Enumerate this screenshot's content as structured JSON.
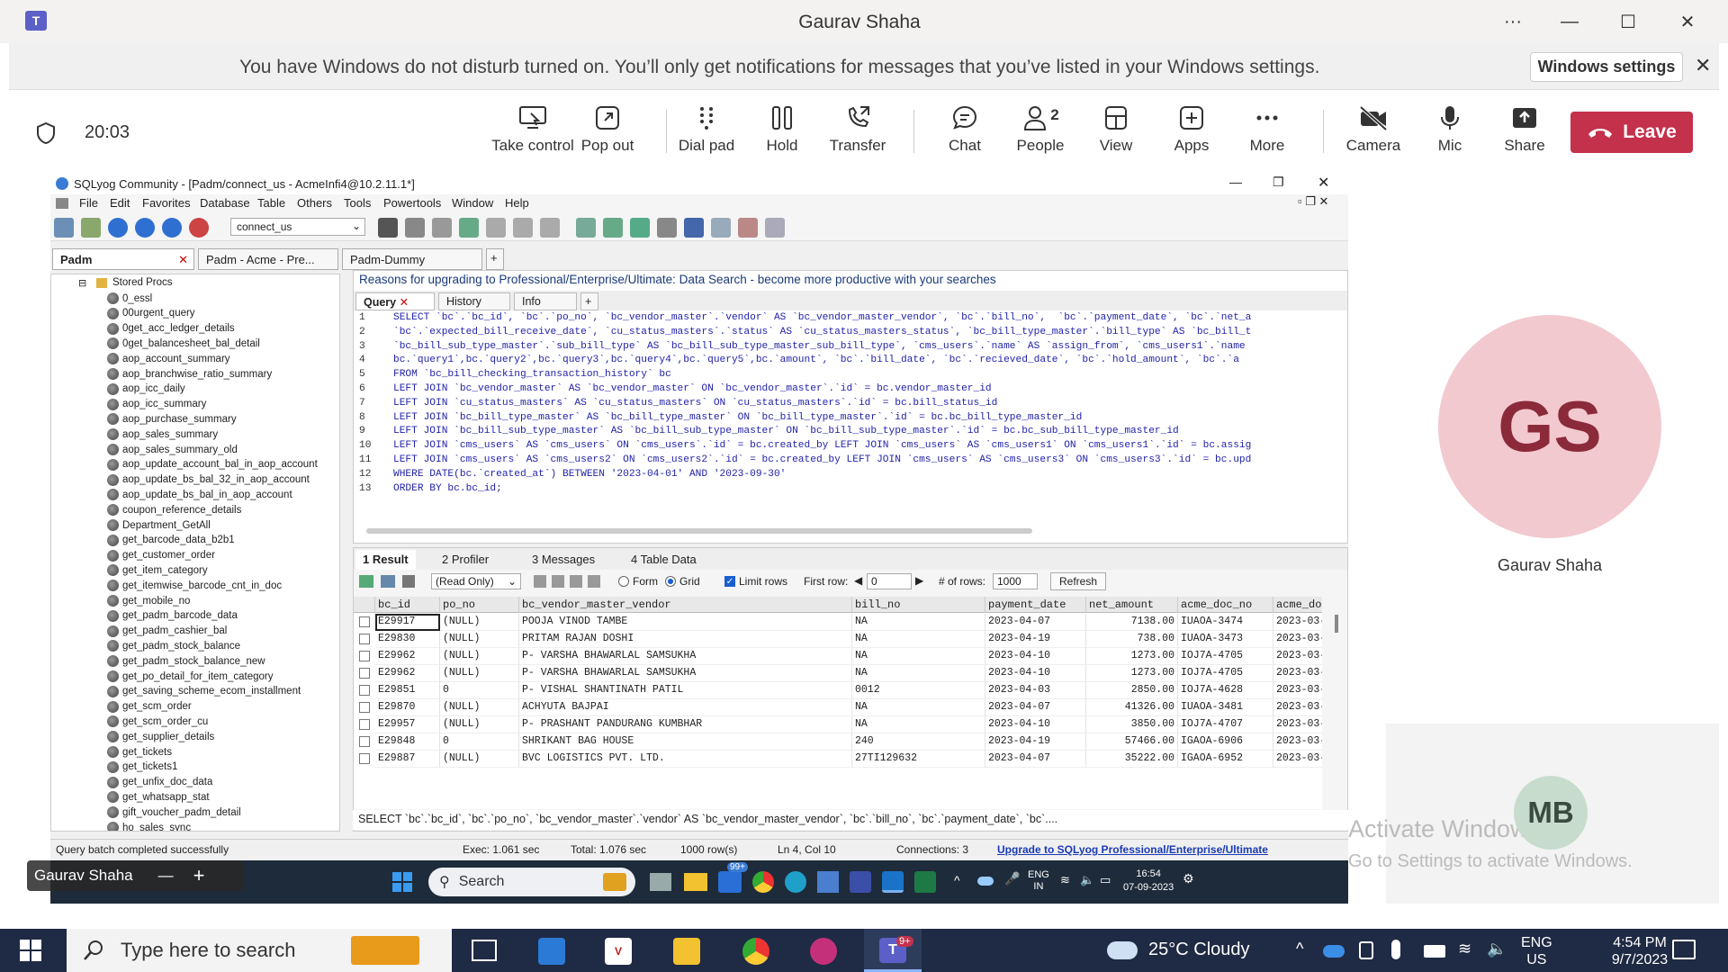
{
  "teams": {
    "title": "Gaurav Shaha",
    "dnd_message": "You have Windows do not disturb turned on. You’ll only get notifications for messages that you’ve listed in your Windows settings.",
    "windows_settings_button": "Windows settings",
    "timer": "20:03",
    "tools": [
      {
        "label": "Take control",
        "icon": "take-control-icon"
      },
      {
        "label": "Pop out",
        "icon": "pop-out-icon"
      },
      {
        "label": "Dial pad",
        "icon": "dial-pad-icon"
      },
      {
        "label": "Hold",
        "icon": "hold-icon"
      },
      {
        "label": "Transfer",
        "icon": "transfer-icon"
      },
      {
        "label": "Chat",
        "icon": "chat-icon"
      },
      {
        "label": "People",
        "icon": "people-icon"
      },
      {
        "label": "View",
        "icon": "view-icon"
      },
      {
        "label": "Apps",
        "icon": "apps-icon"
      },
      {
        "label": "More",
        "icon": "more-icon"
      },
      {
        "label": "Camera",
        "icon": "camera-off-icon"
      },
      {
        "label": "Mic",
        "icon": "mic-icon"
      },
      {
        "label": "Share",
        "icon": "share-icon"
      }
    ],
    "people_count": "2",
    "leave_button": "Leave",
    "participant_main": {
      "initials": "GS",
      "name": "Gaurav Shaha"
    },
    "participant_other": {
      "initials": "MB"
    },
    "presenter_chip": "Gaurav Shaha",
    "activate_windows": "Activate Windows",
    "activate_windows_sub": "Go to Settings to activate Windows."
  },
  "sqlyog": {
    "title": "SQLyog Community - [Padm/connect_us - AcmeInfi4@10.2.11.1*]",
    "menu": [
      "File",
      "Edit",
      "Favorites",
      "Database",
      "Table",
      "Others",
      "Tools",
      "Powertools",
      "Window",
      "Help"
    ],
    "db_selector": "connect_us",
    "connection_tabs": [
      "Padm",
      "Padm - Acme - Pre...",
      "Padm-Dummy"
    ],
    "tree_root": "Stored Procs",
    "procs": [
      "0_essl",
      "00urgent_query",
      "0get_acc_ledger_details",
      "0get_balancesheet_bal_detail",
      "aop_account_summary",
      "aop_branchwise_ratio_summary",
      "aop_icc_daily",
      "aop_icc_summary",
      "aop_purchase_summary",
      "aop_sales_summary",
      "aop_sales_summary_old",
      "aop_update_account_bal_in_aop_account",
      "aop_update_bs_bal_32_in_aop_account",
      "aop_update_bs_bal_in_aop_account",
      "coupon_reference_details",
      "Department_GetAll",
      "get_barcode_data_b2b1",
      "get_customer_order",
      "get_item_category",
      "get_itemwise_barcode_cnt_in_doc",
      "get_mobile_no",
      "get_padm_barcode_data",
      "get_padm_cashier_bal",
      "get_padm_stock_balance",
      "get_padm_stock_balance_new",
      "get_po_detail_for_item_category",
      "get_saving_scheme_ecom_installment",
      "get_scm_order",
      "get_scm_order_cu",
      "get_supplier_details",
      "get_tickets",
      "get_tickets1",
      "get_unfix_doc_data",
      "get_whatsapp_stat",
      "gift_voucher_padm_detail",
      "ho_sales_sync"
    ],
    "reasons_banner": "Reasons for upgrading to Professional/Enterprise/Ultimate: Data Search - become more productive with your searches",
    "query_tabs": [
      "Query",
      "History",
      "Info"
    ],
    "code_lines": [
      "SELECT `bc`.`bc_id`, `bc`.`po_no`, `bc_vendor_master`.`vendor` AS `bc_vendor_master_vendor`, `bc`.`bill_no`,  `bc`.`payment_date`, `bc`.`net_a",
      "`bc`.`expected_bill_receive_date`, `cu_status_masters`.`status` AS `cu_status_masters_status`, `bc_bill_type_master`.`bill_type` AS `bc_bill_t",
      "`bc_bill_sub_type_master`.`sub_bill_type` AS `bc_bill_sub_type_master_sub_bill_type`, `cms_users`.`name` AS `assign_from`, `cms_users1`.`name",
      "bc.`query1`,bc.`query2`,bc.`query3`,bc.`query4`,bc.`query5`,bc.`amount`, `bc`.`bill_date`, `bc`.`recieved_date`, `bc`.`hold_amount`, `bc`.`a",
      "FROM `bc_bill_checking_transaction_history` bc",
      "LEFT JOIN `bc_vendor_master` AS `bc_vendor_master` ON `bc_vendor_master`.`id` = bc.vendor_master_id",
      "LEFT JOIN `cu_status_masters` AS `cu_status_masters` ON `cu_status_masters`.`id` = bc.bill_status_id",
      "LEFT JOIN `bc_bill_type_master` AS `bc_bill_type_master` ON `bc_bill_type_master`.`id` = bc.bc_bill_type_master_id",
      "LEFT JOIN `bc_bill_sub_type_master` AS `bc_bill_sub_type_master` ON `bc_bill_sub_type_master`.`id` = bc.bc_sub_bill_type_master_id",
      "LEFT JOIN `cms_users` AS `cms_users` ON `cms_users`.`id` = bc.created_by LEFT JOIN `cms_users` AS `cms_users1` ON `cms_users1`.`id` = bc.assig",
      "LEFT JOIN `cms_users` AS `cms_users2` ON `cms_users2`.`id` = bc.created_by LEFT JOIN `cms_users` AS `cms_users3` ON `cms_users3`.`id` = bc.upd",
      "WHERE DATE(bc.`created_at`) BETWEEN '2023-04-01' AND '2023-09-30'",
      "ORDER BY bc.bc_id;"
    ],
    "result_tabs": [
      "1 Result",
      "2 Profiler",
      "3 Messages",
      "4 Table Data"
    ],
    "result_toolbar": {
      "mode": "(Read Only)",
      "form": "Form",
      "grid": "Grid",
      "limit_rows": "Limit rows",
      "first_row_label": "First row:",
      "first_row": "0",
      "rows_label": "# of rows:",
      "rows": "1000",
      "refresh": "Refresh"
    },
    "columns": [
      "bc_id",
      "po_no",
      "bc_vendor_master_vendor",
      "bill_no",
      "payment_date",
      "net_amount",
      "acme_doc_no",
      "acme_do"
    ],
    "rows": [
      [
        "E29917",
        "(NULL)",
        "POOJA VINOD TAMBE",
        "NA",
        "2023-04-07",
        "7138.00",
        "IUAOA-3474",
        "2023-03-"
      ],
      [
        "E29830",
        "(NULL)",
        "PRITAM RAJAN DOSHI",
        "NA",
        "2023-04-19",
        "738.00",
        "IUAOA-3473",
        "2023-03-"
      ],
      [
        "E29962",
        "(NULL)",
        "P- VARSHA BHAWARLAL SAMSUKHA",
        "NA",
        "2023-04-10",
        "1273.00",
        "IOJ7A-4705",
        "2023-03-"
      ],
      [
        "E29962",
        "(NULL)",
        "P- VARSHA BHAWARLAL SAMSUKHA",
        "NA",
        "2023-04-10",
        "1273.00",
        "IOJ7A-4705",
        "2023-03-"
      ],
      [
        "E29851",
        "0",
        "P- VISHAL SHANTINATH PATIL",
        "0012",
        "2023-04-03",
        "2850.00",
        "IOJ7A-4628",
        "2023-03-"
      ],
      [
        "E29870",
        "(NULL)",
        "ACHYUTA BAJPAI",
        "NA",
        "2023-04-07",
        "41326.00",
        "IUAOA-3481",
        "2023-03-"
      ],
      [
        "E29957",
        "(NULL)",
        "P- PRASHANT PANDURANG KUMBHAR",
        "NA",
        "2023-04-10",
        "3850.00",
        "IOJ7A-4707",
        "2023-03-"
      ],
      [
        "E29848",
        "0",
        "SHRIKANT BAG HOUSE",
        "240",
        "2023-04-19",
        "57466.00",
        "IGAOA-6906",
        "2023-03-"
      ],
      [
        "E29887",
        "(NULL)",
        "BVC LOGISTICS PVT. LTD.",
        "27TI129632",
        "2023-04-07",
        "35222.00",
        "IGAOA-6952",
        "2023-03-"
      ]
    ],
    "sql_preview": "SELECT `bc`.`bc_id`, `bc`.`po_no`, `bc_vendor_master`.`vendor` AS `bc_vendor_master_vendor`, `bc`.`bill_no`, `bc`.`payment_date`, `bc`....",
    "status": {
      "message": "Query batch completed successfully",
      "exec": "Exec: 1.061 sec",
      "total": "Total: 1.076 sec",
      "rows": "1000 row(s)",
      "pos": "Ln 4, Col 10",
      "connections": "Connections: 3",
      "upgrade": "Upgrade to SQLyog Professional/Enterprise/Ultimate"
    },
    "remote_taskbar": {
      "search": "Search",
      "lang1": "ENG",
      "lang2": "IN",
      "time": "16:54",
      "date": "07-09-2023",
      "badge": "99+"
    }
  },
  "windows": {
    "search_placeholder": "Type here to search",
    "weather": "25°C  Cloudy",
    "lang1": "ENG",
    "lang2": "US",
    "time": "4:54 PM",
    "date": "9/7/2023",
    "teams_badge": "9+"
  },
  "colors": {
    "teams_accent": "#6264a7",
    "leave_red": "#c4314b",
    "gs_bg": "#f2c9cf",
    "mb_bg": "#c8dccd",
    "taskbar": "#1f2a44"
  }
}
